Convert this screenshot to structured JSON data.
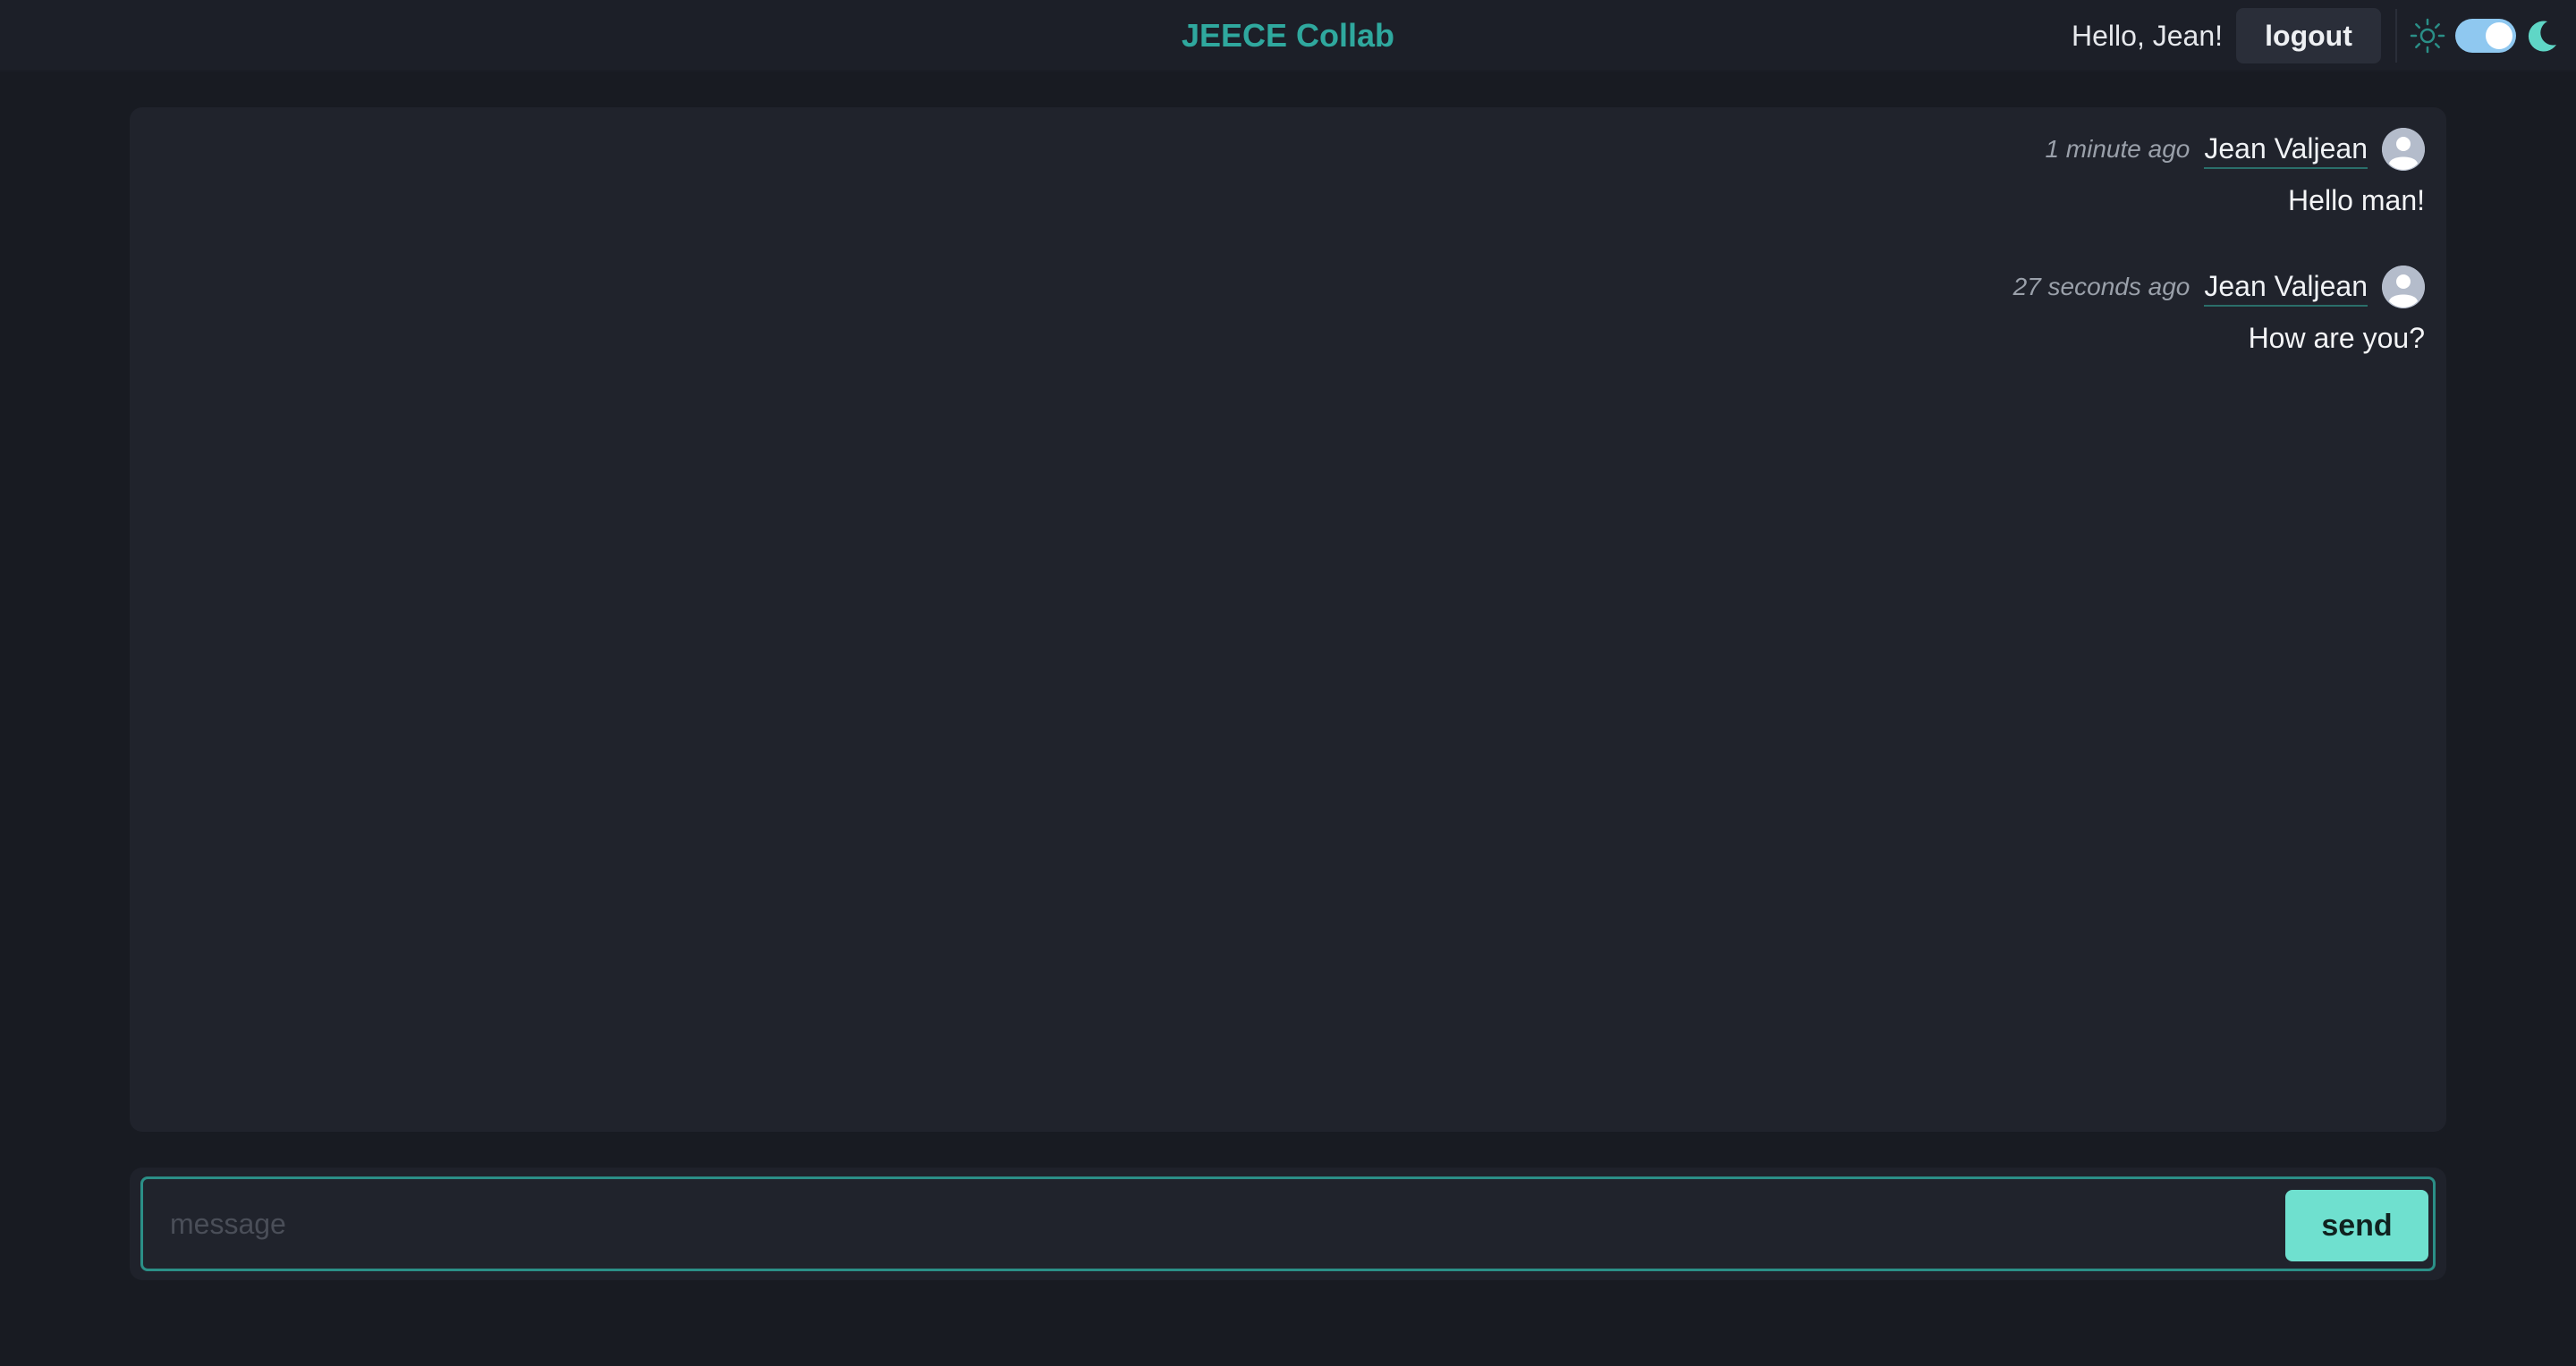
{
  "header": {
    "app_title": "JEECE Collab",
    "greeting": "Hello, Jean!",
    "logout_label": "logout",
    "theme_toggle": {
      "mode": "dark",
      "light_icon": "sun-icon",
      "dark_icon": "moon-icon"
    }
  },
  "messages": [
    {
      "time": "1 minute ago",
      "author": "Jean Valjean",
      "text": "Hello man!",
      "avatar_icon": "user-avatar-icon"
    },
    {
      "time": "27 seconds ago",
      "author": "Jean Valjean",
      "text": "How are you?",
      "avatar_icon": "user-avatar-icon"
    }
  ],
  "composer": {
    "placeholder": "message",
    "value": "",
    "send_label": "send"
  },
  "colors": {
    "accent": "#2fa89e",
    "send_button": "#6fe0cf",
    "toggle_track": "#8fc8f0",
    "background": "#181b22",
    "panel": "#20232c"
  }
}
